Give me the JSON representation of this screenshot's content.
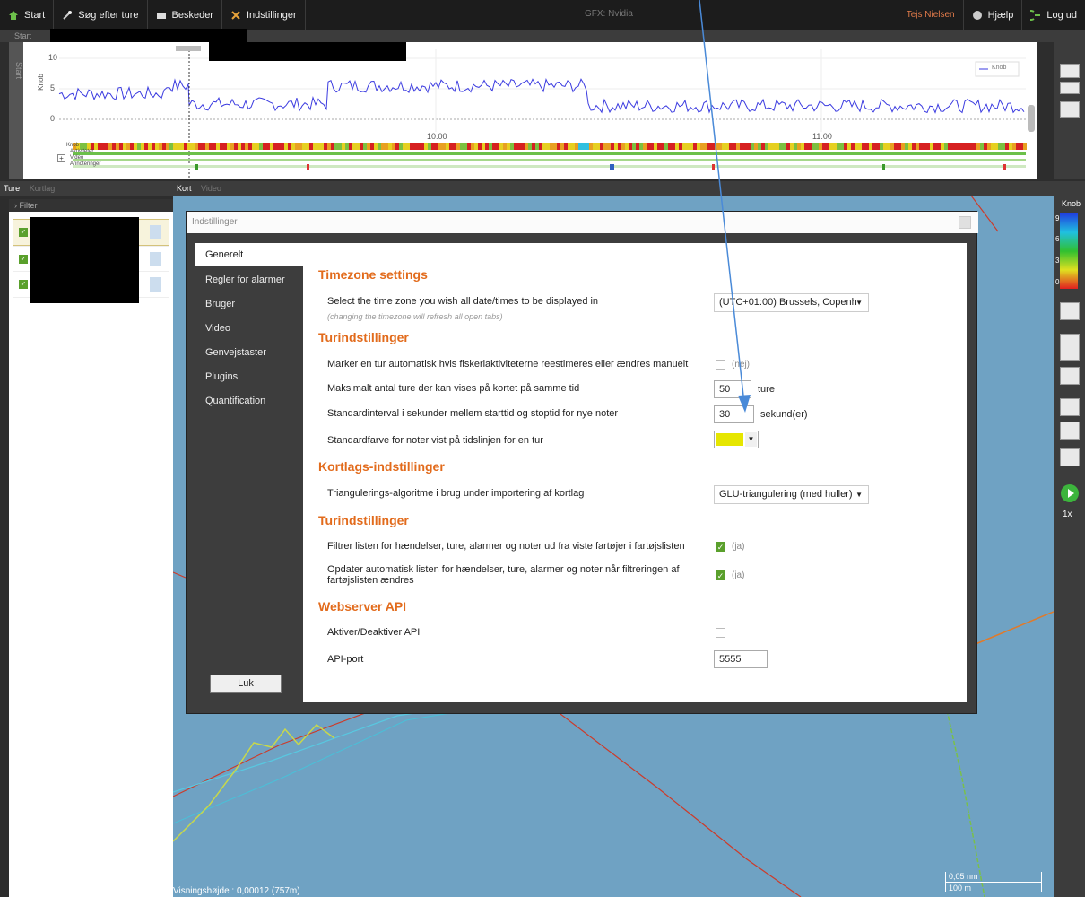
{
  "topbar": {
    "start": "Start",
    "search": "Søg efter ture",
    "messages": "Beskeder",
    "settings": "Indstillinger",
    "gfx": "GFX: Nvidia",
    "user": "Tejs Nielsen",
    "help": "Hjælp",
    "logout": "Log ud"
  },
  "timeline": {
    "tab": "Start",
    "side_label": "Start",
    "ylabel": "Knob",
    "yticks": [
      "10",
      "5",
      "0"
    ],
    "xticks": [
      "10:00",
      "11:00"
    ],
    "legend": "Knob",
    "rows": [
      "Knob",
      "Aktiviteter",
      "Video",
      "Annoteringer"
    ]
  },
  "left_panel": {
    "tabs": [
      "Ture",
      "Kortlag"
    ],
    "filter": "Filter"
  },
  "map_panel": {
    "tabs": [
      "Kort",
      "Video"
    ],
    "visnings": "Visningshøjde : 0,00012 (757m)",
    "scale_top": "0,05 nm",
    "scale_bottom": "100 m"
  },
  "right_bar": {
    "title": "Knob",
    "scale": [
      "9",
      "6",
      "3",
      "0"
    ],
    "speed": "1x"
  },
  "dialog": {
    "title": "Indstillinger",
    "nav": [
      "Generelt",
      "Regler for alarmer",
      "Bruger",
      "Video",
      "Genvejstaster",
      "Plugins",
      "Quantification"
    ],
    "close": "Luk",
    "sections": {
      "timezone": "Timezone settings",
      "tur1": "Turindstillinger",
      "kort": "Kortlags-indstillinger",
      "tur2": "Turindstillinger",
      "api": "Webserver API"
    },
    "rows": {
      "tz_label": "Select the time zone you wish all date/times to be displayed in",
      "tz_note": "(changing the timezone will refresh all open tabs)",
      "tz_value": "(UTC+01:00) Brussels, Copenh",
      "mark_label": "Marker en tur automatisk hvis fiskeriaktiviteterne reestimeres eller ændres manuelt",
      "mark_state": "(nej)",
      "max_label": "Maksimalt antal ture der kan vises på kortet på samme tid",
      "max_value": "50",
      "max_unit": "ture",
      "interval_label": "Standardinterval i sekunder mellem starttid og stoptid for nye noter",
      "interval_value": "30",
      "interval_unit": "sekund(er)",
      "color_label": "Standardfarve for noter vist på tidslinjen for en tur",
      "tri_label": "Triangulerings-algoritme i brug under importering af kortlag",
      "tri_value": "GLU-triangulering (med huller)",
      "filter_label": "Filtrer listen for hændelser, ture, alarmer og noter ud fra viste fartøjer i fartøjslisten",
      "filter_state": "(ja)",
      "update_label": "Opdater automatisk listen for hændelser, ture, alarmer og noter når filtreringen af fartøjslisten ændres",
      "update_state": "(ja)",
      "api_label": "Aktiver/Deaktiver API",
      "port_label": "API-port",
      "port_value": "5555"
    }
  },
  "colors": {
    "accent": "#e26b1c",
    "map": "#6fa2c3",
    "note_color": "#e6e600"
  }
}
